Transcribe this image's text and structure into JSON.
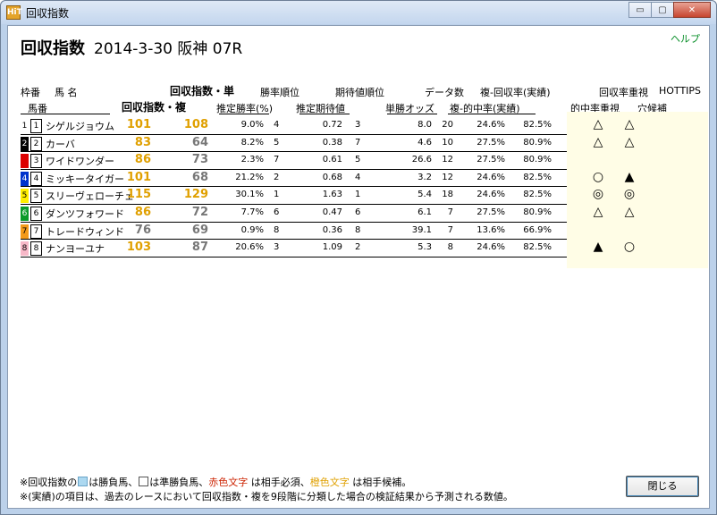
{
  "window": {
    "title": "回収指数",
    "app_icon_text": "HiT",
    "buttons": {
      "minimize": "▭",
      "maximize": "▢",
      "close": "✕"
    }
  },
  "help_label": "ヘルプ",
  "race": {
    "lead": "回収指数",
    "detail": "2014-3-30 阪神 07R"
  },
  "headers": {
    "waku": "枠番",
    "name": "馬 名",
    "umaban": "馬番",
    "index_win": "回収指数・単",
    "index_place": "回収指数・複",
    "win_rank": "勝率順位",
    "est_win_rate": "推定勝率(%)",
    "ev_rank": "期待値順位",
    "est_ev": "推定期待値",
    "data_count": "データ数",
    "win_odds": "単勝オッズ",
    "place_hit_recovery": "複-回収率(実績)",
    "place_hit_rate": "複-的中率(実績)",
    "recovery_focus": "回収率重視",
    "hit_focus": "的中率重視",
    "hottips": "HOTTIPS",
    "dark_horse": "穴候補"
  },
  "horses": [
    {
      "waku": "1",
      "waku_color": "#ffffff",
      "waku_text": "#000000",
      "umaban": "1",
      "name": "シゲルジョウム",
      "idx_win": "101",
      "idx_win_color": "#e0a000",
      "idx_place": "108",
      "idx_place_color": "#e0a000",
      "win_rate": "9.0%",
      "win_rank": "4",
      "ev": "0.72",
      "ev_rank": "3",
      "odds": "8.0",
      "count": "20",
      "hit_rate": "24.6%",
      "recovery": "82.5%",
      "mark1": "△",
      "mark2": "△"
    },
    {
      "waku": "2",
      "waku_color": "#000000",
      "waku_text": "#ffffff",
      "umaban": "2",
      "name": "カーバ",
      "idx_win": "83",
      "idx_win_color": "#e0a000",
      "idx_place": "64",
      "idx_place_color": "#777777",
      "win_rate": "8.2%",
      "win_rank": "5",
      "ev": "0.38",
      "ev_rank": "7",
      "odds": "4.6",
      "count": "10",
      "hit_rate": "27.5%",
      "recovery": "80.9%",
      "mark1": "△",
      "mark2": "△"
    },
    {
      "waku": "3",
      "waku_color": "#dd0000",
      "waku_text": "#dd0000",
      "umaban": "3",
      "name": "ワイドワンダー",
      "idx_win": "86",
      "idx_win_color": "#e0a000",
      "idx_place": "73",
      "idx_place_color": "#777777",
      "win_rate": "2.3%",
      "win_rank": "7",
      "ev": "0.61",
      "ev_rank": "5",
      "odds": "26.6",
      "count": "12",
      "hit_rate": "27.5%",
      "recovery": "80.9%",
      "mark1": "",
      "mark2": ""
    },
    {
      "waku": "4",
      "waku_color": "#0033cc",
      "waku_text": "#ffffff",
      "umaban": "4",
      "name": "ミッキータイガー",
      "idx_win": "101",
      "idx_win_color": "#e0a000",
      "idx_place": "68",
      "idx_place_color": "#777777",
      "win_rate": "21.2%",
      "win_rank": "2",
      "ev": "0.68",
      "ev_rank": "4",
      "odds": "3.2",
      "count": "12",
      "hit_rate": "24.6%",
      "recovery": "82.5%",
      "mark1": "○",
      "mark2": "▲"
    },
    {
      "waku": "5",
      "waku_color": "#ffee00",
      "waku_text": "#000000",
      "umaban": "5",
      "name": "スリーヴェローチェ",
      "idx_win": "115",
      "idx_win_color": "#e0a000",
      "idx_place": "129",
      "idx_place_color": "#e0a000",
      "win_rate": "30.1%",
      "win_rank": "1",
      "ev": "1.63",
      "ev_rank": "1",
      "odds": "5.4",
      "count": "18",
      "hit_rate": "24.6%",
      "recovery": "82.5%",
      "mark1": "◎",
      "mark2": "◎"
    },
    {
      "waku": "6",
      "waku_color": "#0a9a2a",
      "waku_text": "#ffffff",
      "umaban": "6",
      "name": "ダンツフォワード",
      "idx_win": "86",
      "idx_win_color": "#e0a000",
      "idx_place": "72",
      "idx_place_color": "#777777",
      "win_rate": "7.7%",
      "win_rank": "6",
      "ev": "0.47",
      "ev_rank": "6",
      "odds": "6.1",
      "count": "7",
      "hit_rate": "27.5%",
      "recovery": "80.9%",
      "mark1": "△",
      "mark2": "△"
    },
    {
      "waku": "7",
      "waku_color": "#f39a1a",
      "waku_text": "#000000",
      "umaban": "7",
      "name": "トレードウィンド",
      "idx_win": "76",
      "idx_win_color": "#777777",
      "idx_place": "69",
      "idx_place_color": "#777777",
      "win_rate": "0.9%",
      "win_rank": "8",
      "ev": "0.36",
      "ev_rank": "8",
      "odds": "39.1",
      "count": "7",
      "hit_rate": "13.6%",
      "recovery": "66.9%",
      "mark1": "",
      "mark2": ""
    },
    {
      "waku": "8",
      "waku_color": "#f7b8c8",
      "waku_text": "#000000",
      "umaban": "8",
      "name": "ナンヨーユナ",
      "idx_win": "103",
      "idx_win_color": "#e0a000",
      "idx_place": "87",
      "idx_place_color": "#777777",
      "win_rate": "20.6%",
      "win_rank": "3",
      "ev": "1.09",
      "ev_rank": "2",
      "odds": "5.3",
      "count": "8",
      "hit_rate": "24.6%",
      "recovery": "82.5%",
      "mark1": "▲",
      "mark2": "○"
    }
  ],
  "footer": {
    "line1_a": "※回収指数の",
    "line1_b": "は勝負馬、",
    "line1_c": "は準勝負馬、",
    "line1_red": "赤色文字",
    "line1_d": " は相手必須、",
    "line1_orange": "橙色文字",
    "line1_e": " は相手候補。",
    "line2": "※(実績)の項目は、過去のレースにおいて回収指数・複を9段階に分類した場合の検証結果から予測される数値。"
  },
  "close_button_label": "閉じる"
}
